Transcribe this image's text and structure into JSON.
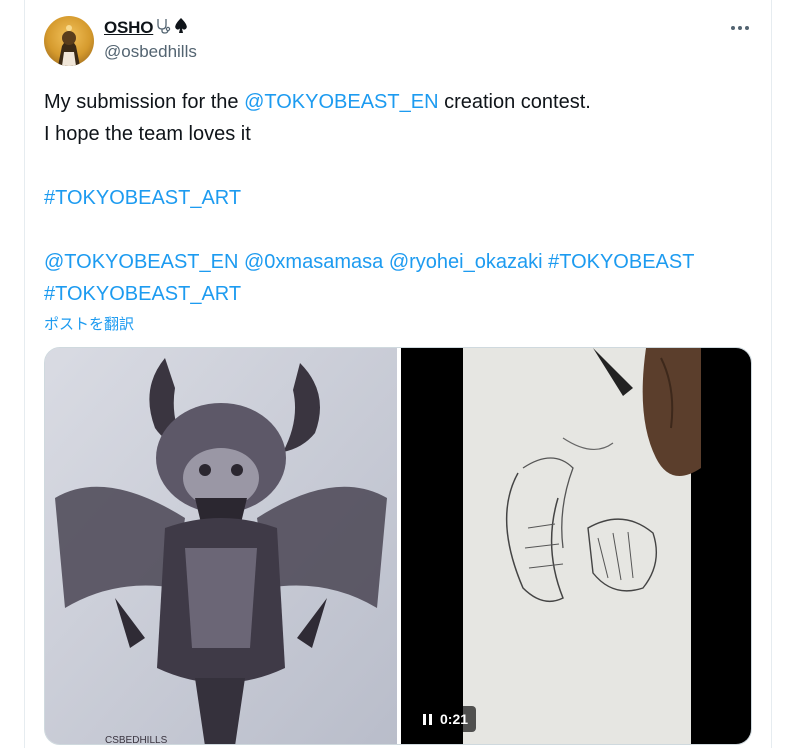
{
  "author": {
    "display_name": "OSHO",
    "handle": "@osbedhills"
  },
  "icons": {
    "name_badges": [
      "stethoscope-icon",
      "spade-icon"
    ],
    "more": "more-icon",
    "pause": "pause-icon"
  },
  "tweet": {
    "line1": {
      "before": "My submission for the ",
      "mention": "@TOKYOBEAST_EN",
      "after": " creation contest."
    },
    "line2": "I hope the team loves it",
    "hashtag1": "#TOKYOBEAST_ART",
    "line5": {
      "mention1": "@TOKYOBEAST_EN",
      "mention2": "@0xmasamasa",
      "mention3": "@ryohei_okazaki",
      "hashtag": "#TOKYOBEAST"
    },
    "hashtag2": "#TOKYOBEAST_ART"
  },
  "translate_label": "ポストを翻訳",
  "media": {
    "video_time": "0:21",
    "video_playing": true
  },
  "colors": {
    "link": "#1d9bf0",
    "text": "#0f1419",
    "secondary": "#536471"
  }
}
